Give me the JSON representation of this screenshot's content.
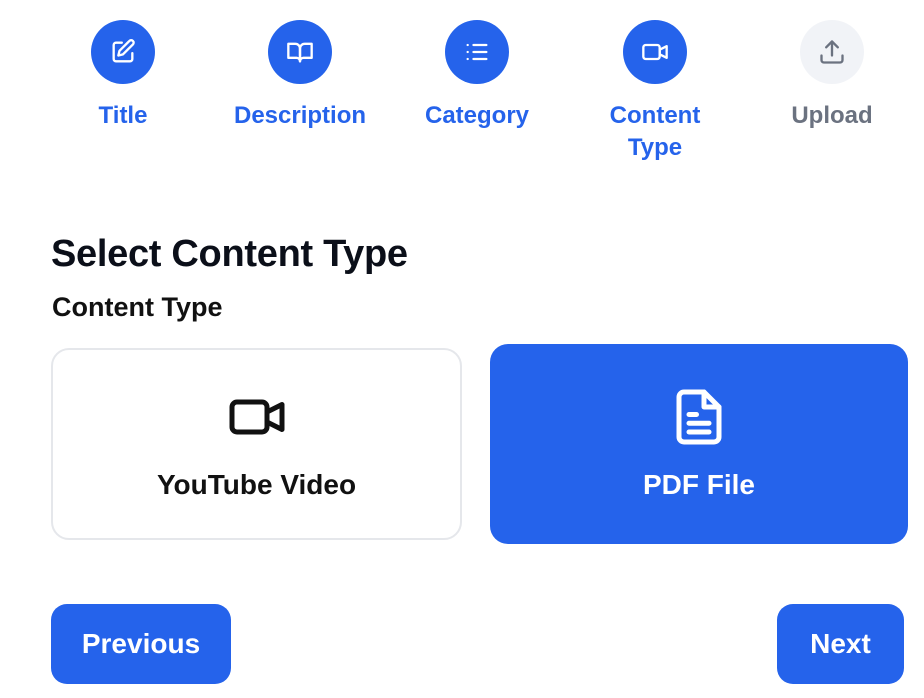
{
  "stepper": {
    "steps": [
      {
        "label": "Title",
        "icon": "edit-icon",
        "status": "complete"
      },
      {
        "label": "Description",
        "icon": "book-icon",
        "status": "complete"
      },
      {
        "label": "Category",
        "icon": "list-icon",
        "status": "complete"
      },
      {
        "label": "Content Type",
        "icon": "video-icon",
        "status": "current"
      },
      {
        "label": "Upload",
        "icon": "upload-icon",
        "status": "pending"
      }
    ]
  },
  "heading": "Select Content Type",
  "field_label": "Content Type",
  "options": [
    {
      "label": "YouTube Video",
      "icon": "video-camera-icon",
      "selected": false
    },
    {
      "label": "PDF File",
      "icon": "document-icon",
      "selected": true
    }
  ],
  "nav": {
    "previous_label": "Previous",
    "next_label": "Next"
  },
  "colors": {
    "accent": "#2563eb",
    "pending_bg": "#f1f3f7",
    "pending_text": "#6b7280",
    "card_border": "#e5e7eb"
  }
}
